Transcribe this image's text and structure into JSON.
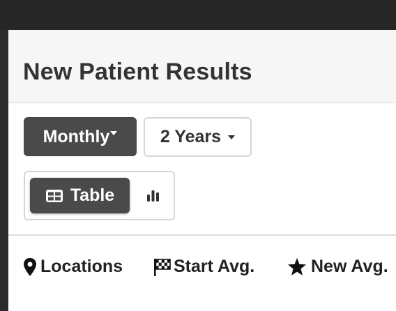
{
  "header": {
    "title": "New Patient Results"
  },
  "filters": {
    "period": {
      "label": "Monthly",
      "selected": true
    },
    "range": {
      "label": "2 Years",
      "selected": false
    }
  },
  "view_toggle": {
    "table": {
      "label": "Table",
      "icon": "table-icon",
      "selected": true
    },
    "chart": {
      "icon": "bar-chart-icon",
      "selected": false
    }
  },
  "legend": {
    "items": [
      {
        "label": "Locations",
        "icon": "map-marker-icon"
      },
      {
        "label": "Start Avg.",
        "icon": "checkered-flag-icon"
      },
      {
        "label": "New Avg.",
        "icon": "star-icon"
      }
    ]
  },
  "colors": {
    "topbar": "#262626",
    "button_dark": "#4a4a4a",
    "header_band": "#f6f6f6",
    "border": "#d6d6d6"
  }
}
